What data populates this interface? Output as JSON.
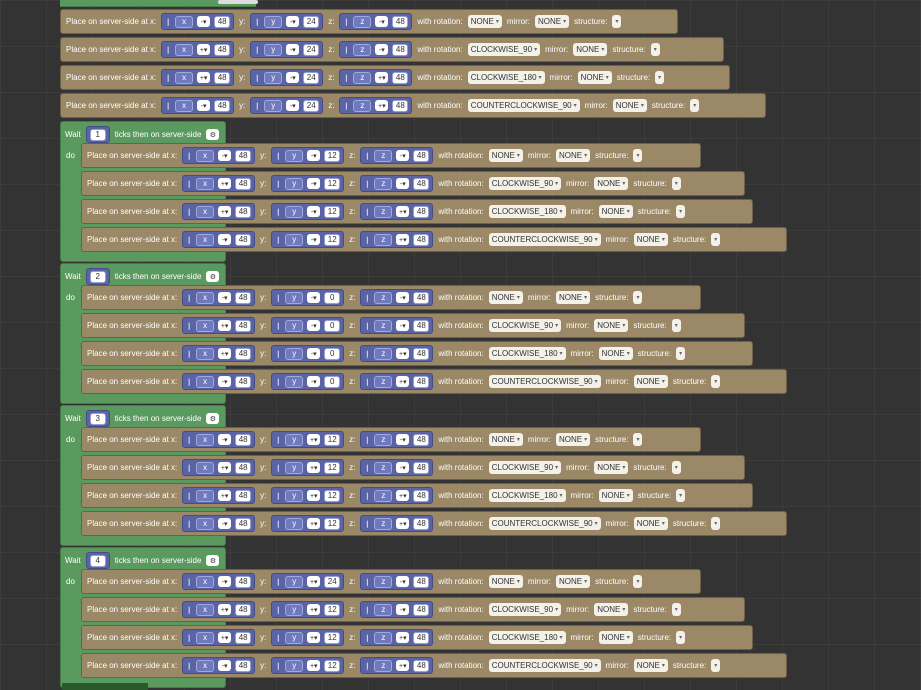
{
  "workspace": {
    "labels": {
      "place": "Place on server-side at x:",
      "y": "y:",
      "z": "z:",
      "rotation": "with rotation:",
      "mirror": "mirror:",
      "structure": "structure:",
      "wait": "Wait",
      "ticks": "ticks then on server-side",
      "do": "do"
    },
    "top_blocks": [
      {
        "x": [
          "x",
          "-",
          "48"
        ],
        "y": [
          "y",
          "-",
          "24"
        ],
        "z": [
          "z",
          "-",
          "48"
        ],
        "rotation": "NONE",
        "mirror": "NONE"
      },
      {
        "x": [
          "x",
          "+",
          "48"
        ],
        "y": [
          "y",
          "-",
          "24"
        ],
        "z": [
          "z",
          "-",
          "48"
        ],
        "rotation": "CLOCKWISE_90",
        "mirror": "NONE"
      },
      {
        "x": [
          "x",
          "+",
          "48"
        ],
        "y": [
          "y",
          "-",
          "24"
        ],
        "z": [
          "z",
          "+",
          "48"
        ],
        "rotation": "CLOCKWISE_180",
        "mirror": "NONE"
      },
      {
        "x": [
          "x",
          "-",
          "48"
        ],
        "y": [
          "y",
          "-",
          "24"
        ],
        "z": [
          "z",
          "+",
          "48"
        ],
        "rotation": "COUNTERCLOCKWISE_90",
        "mirror": "NONE"
      }
    ],
    "wait_groups": [
      {
        "ticks": "1",
        "blocks": [
          {
            "x": [
              "x",
              "-",
              "48"
            ],
            "y": [
              "y",
              "-",
              "12"
            ],
            "z": [
              "z",
              "-",
              "48"
            ],
            "rotation": "NONE",
            "mirror": "NONE"
          },
          {
            "x": [
              "x",
              "+",
              "48"
            ],
            "y": [
              "y",
              "-",
              "12"
            ],
            "z": [
              "z",
              "-",
              "48"
            ],
            "rotation": "CLOCKWISE_90",
            "mirror": "NONE"
          },
          {
            "x": [
              "x",
              "+",
              "48"
            ],
            "y": [
              "y",
              "-",
              "12"
            ],
            "z": [
              "z",
              "+",
              "48"
            ],
            "rotation": "CLOCKWISE_180",
            "mirror": "NONE"
          },
          {
            "x": [
              "x",
              "-",
              "48"
            ],
            "y": [
              "y",
              "-",
              "12"
            ],
            "z": [
              "z",
              "+",
              "48"
            ],
            "rotation": "COUNTERCLOCKWISE_90",
            "mirror": "NONE"
          }
        ]
      },
      {
        "ticks": "2",
        "blocks": [
          {
            "x": [
              "x",
              "-",
              "48"
            ],
            "y": [
              "y",
              "-",
              "0"
            ],
            "z": [
              "z",
              "-",
              "48"
            ],
            "rotation": "NONE",
            "mirror": "NONE"
          },
          {
            "x": [
              "x",
              "+",
              "48"
            ],
            "y": [
              "y",
              "-",
              "0"
            ],
            "z": [
              "z",
              "-",
              "48"
            ],
            "rotation": "CLOCKWISE_90",
            "mirror": "NONE"
          },
          {
            "x": [
              "x",
              "+",
              "48"
            ],
            "y": [
              "y",
              "-",
              "0"
            ],
            "z": [
              "z",
              "+",
              "48"
            ],
            "rotation": "CLOCKWISE_180",
            "mirror": "NONE"
          },
          {
            "x": [
              "x",
              "-",
              "48"
            ],
            "y": [
              "y",
              "-",
              "0"
            ],
            "z": [
              "z",
              "+",
              "48"
            ],
            "rotation": "COUNTERCLOCKWISE_90",
            "mirror": "NONE"
          }
        ]
      },
      {
        "ticks": "3",
        "blocks": [
          {
            "x": [
              "x",
              "-",
              "48"
            ],
            "y": [
              "y",
              "+",
              "12"
            ],
            "z": [
              "z",
              "-",
              "48"
            ],
            "rotation": "NONE",
            "mirror": "NONE"
          },
          {
            "x": [
              "x",
              "+",
              "48"
            ],
            "y": [
              "y",
              "+",
              "12"
            ],
            "z": [
              "z",
              "-",
              "48"
            ],
            "rotation": "CLOCKWISE_90",
            "mirror": "NONE"
          },
          {
            "x": [
              "x",
              "+",
              "48"
            ],
            "y": [
              "y",
              "+",
              "12"
            ],
            "z": [
              "z",
              "+",
              "48"
            ],
            "rotation": "CLOCKWISE_180",
            "mirror": "NONE"
          },
          {
            "x": [
              "x",
              "-",
              "48"
            ],
            "y": [
              "y",
              "+",
              "12"
            ],
            "z": [
              "z",
              "+",
              "48"
            ],
            "rotation": "COUNTERCLOCKWISE_90",
            "mirror": "NONE"
          }
        ]
      },
      {
        "ticks": "4",
        "blocks": [
          {
            "x": [
              "x",
              "-",
              "48"
            ],
            "y": [
              "y",
              "+",
              "24"
            ],
            "z": [
              "z",
              "-",
              "48"
            ],
            "rotation": "NONE",
            "mirror": "NONE"
          },
          {
            "x": [
              "x",
              "+",
              "48"
            ],
            "y": [
              "y",
              "+",
              "12"
            ],
            "z": [
              "z",
              "-",
              "48"
            ],
            "rotation": "CLOCKWISE_90",
            "mirror": "NONE"
          },
          {
            "x": [
              "x",
              "+",
              "48"
            ],
            "y": [
              "y",
              "+",
              "12"
            ],
            "z": [
              "z",
              "+",
              "48"
            ],
            "rotation": "CLOCKWISE_180",
            "mirror": "NONE"
          },
          {
            "x": [
              "x",
              "-",
              "48"
            ],
            "y": [
              "y",
              "+",
              "12"
            ],
            "z": [
              "z",
              "+",
              "48"
            ],
            "rotation": "COUNTERCLOCKWISE_90",
            "mirror": "NONE"
          }
        ]
      }
    ],
    "colors": {
      "workspace_bg": "#333333",
      "place_block": "#9a8866",
      "math_block": "#5a63a3",
      "wait_block": "#5b9a5f"
    },
    "icons": {
      "gear": "gear-icon",
      "dropdown": "dropdown-arrow-icon",
      "handle": "drag-handle-icon"
    }
  }
}
